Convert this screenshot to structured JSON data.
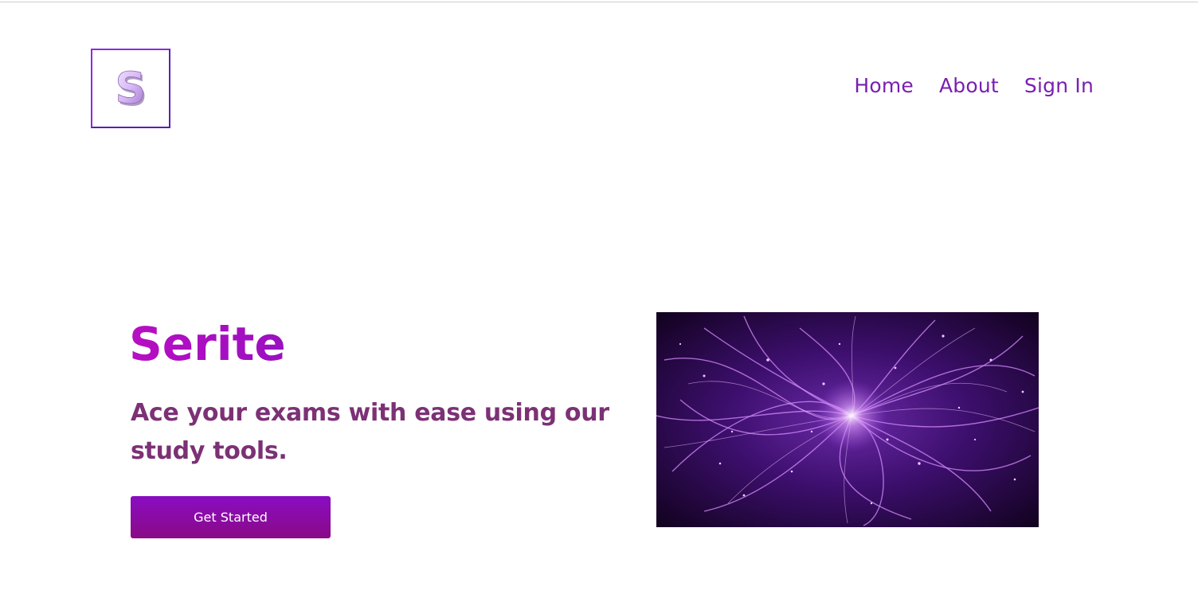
{
  "logo": {
    "letter": "S",
    "icon": "logo-s-icon"
  },
  "nav": {
    "items": [
      {
        "label": "Home"
      },
      {
        "label": "About"
      },
      {
        "label": "Sign In"
      }
    ]
  },
  "hero": {
    "title": "Serite",
    "subtitle": "Ace your exams with ease using our study tools.",
    "cta_label": "Get Started",
    "image": "particle-swirl-image"
  },
  "colors": {
    "brand_purple": "#7a1fb0",
    "title_magenta": "#b00fbd",
    "subtitle_plum": "#7c3175",
    "button_top": "#8a0cc2",
    "button_bottom": "#8a0a87"
  }
}
